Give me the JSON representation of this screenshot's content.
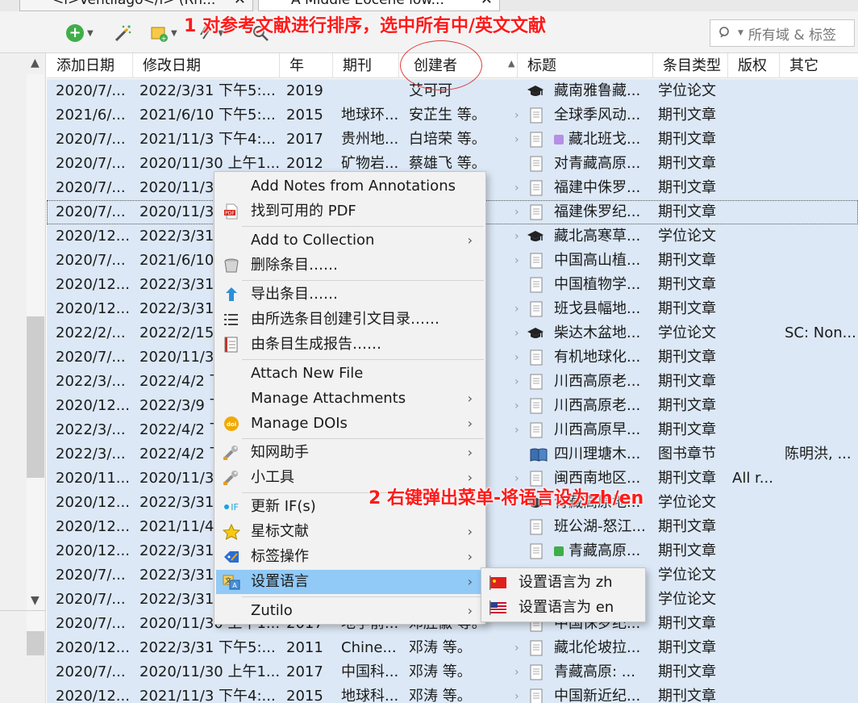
{
  "tabs": [
    {
      "label": "<i>Ventilago</i> (Rh...",
      "close": "✕"
    },
    {
      "label": "A Middle Eocene low...",
      "close": "✕"
    }
  ],
  "toolbar": {
    "search_placeholder": "所有域 & 标签"
  },
  "columns": [
    "添加日期",
    "修改日期",
    "年",
    "期刊",
    "创建者",
    "标题",
    "条目类型",
    "版权",
    "其它"
  ],
  "rows": [
    {
      "added": "2020/7/...",
      "modified": "2022/3/31 下午5:...",
      "year": "2019",
      "journal": "",
      "creator": "艾可可",
      "twisty": false,
      "icon": "thesis",
      "tag": "",
      "title": "藏南雅鲁藏...",
      "type": "学位论文",
      "rights": "",
      "extra": ""
    },
    {
      "added": "2021/6/...",
      "modified": "2021/6/10 下午5:...",
      "year": "2015",
      "journal": "地球环...",
      "creator": "安芷生 等。",
      "twisty": true,
      "icon": "article",
      "tag": "",
      "title": "全球季风动...",
      "type": "期刊文章",
      "rights": "",
      "extra": ""
    },
    {
      "added": "2020/7/...",
      "modified": "2021/11/3 下午4:...",
      "year": "2017",
      "journal": "贵州地...",
      "creator": "白培荣 等。",
      "twisty": true,
      "icon": "article",
      "tag": "#b58ee6",
      "title": "藏北班戈...",
      "type": "期刊文章",
      "rights": "",
      "extra": ""
    },
    {
      "added": "2020/7/...",
      "modified": "2020/11/30 上午1...",
      "year": "2012",
      "journal": "矿物岩...",
      "creator": "蔡雄飞 等。",
      "twisty": false,
      "icon": "article",
      "tag": "",
      "title": "对青藏高原...",
      "type": "期刊文章",
      "rights": "",
      "extra": ""
    },
    {
      "added": "2020/7/...",
      "modified": "2020/11/30",
      "year": "",
      "journal": "",
      "creator": "",
      "twisty": true,
      "icon": "article",
      "tag": "",
      "title": "福建中侏罗...",
      "type": "期刊文章",
      "rights": "",
      "extra": ""
    },
    {
      "added": "2020/7/...",
      "modified": "2020/11/30",
      "year": "",
      "journal": "",
      "creator": "",
      "twisty": true,
      "icon": "article",
      "tag": "",
      "title": "福建侏罗纪...",
      "type": "期刊文章",
      "rights": "",
      "extra": ""
    },
    {
      "added": "2020/12...",
      "modified": "2022/3/31",
      "year": "",
      "journal": "",
      "creator": "",
      "twisty": true,
      "icon": "thesis",
      "tag": "",
      "title": "藏北高寒草...",
      "type": "学位论文",
      "rights": "",
      "extra": ""
    },
    {
      "added": "2020/7/...",
      "modified": "2021/6/10",
      "year": "",
      "journal": "",
      "creator": "",
      "twisty": true,
      "icon": "article",
      "tag": "",
      "title": "中国高山植...",
      "type": "期刊文章",
      "rights": "",
      "extra": ""
    },
    {
      "added": "2020/12...",
      "modified": "2022/3/31",
      "year": "",
      "journal": "",
      "creator": "",
      "twisty": false,
      "icon": "article",
      "tag": "",
      "title": "中国植物学...",
      "type": "期刊文章",
      "rights": "",
      "extra": ""
    },
    {
      "added": "2020/12...",
      "modified": "2022/3/31",
      "year": "",
      "journal": "",
      "creator": "",
      "twisty": true,
      "icon": "article",
      "tag": "",
      "title": "班戈县幅地...",
      "type": "期刊文章",
      "rights": "",
      "extra": ""
    },
    {
      "added": "2022/2/...",
      "modified": "2022/2/15",
      "year": "",
      "journal": "",
      "creator": "",
      "twisty": true,
      "icon": "thesis",
      "tag": "",
      "title": "柴达木盆地...",
      "type": "学位论文",
      "rights": "",
      "extra": "SC: Non..."
    },
    {
      "added": "2020/7/...",
      "modified": "2020/11/30",
      "year": "",
      "journal": "",
      "creator": "",
      "twisty": true,
      "icon": "article",
      "tag": "",
      "title": "有机地球化...",
      "type": "期刊文章",
      "rights": "",
      "extra": ""
    },
    {
      "added": "2022/3/...",
      "modified": "2022/4/2 下",
      "year": "",
      "journal": "",
      "creator": "",
      "twisty": true,
      "icon": "article",
      "tag": "",
      "title": "川西高原老...",
      "type": "期刊文章",
      "rights": "",
      "extra": ""
    },
    {
      "added": "2020/12...",
      "modified": "2022/3/9 下",
      "year": "",
      "journal": "",
      "creator": "",
      "twisty": true,
      "icon": "article",
      "tag": "",
      "title": "川西高原老...",
      "type": "期刊文章",
      "rights": "",
      "extra": ""
    },
    {
      "added": "2022/3/...",
      "modified": "2022/4/2 下",
      "year": "",
      "journal": "",
      "creator": "",
      "twisty": true,
      "icon": "article",
      "tag": "",
      "title": "川西高原早...",
      "type": "期刊文章",
      "rights": "",
      "extra": ""
    },
    {
      "added": "2022/3/...",
      "modified": "2022/4/2 下",
      "year": "",
      "journal": "",
      "creator": "",
      "twisty": false,
      "icon": "book",
      "tag": "",
      "title": "四川理塘木...",
      "type": "图书章节",
      "rights": "",
      "extra": "陈明洪, ..."
    },
    {
      "added": "2020/11...",
      "modified": "2020/11/30",
      "year": "",
      "journal": "",
      "creator": "",
      "twisty": true,
      "icon": "article",
      "tag": "",
      "title": "闽西南地区...",
      "type": "期刊文章",
      "rights": "All r...",
      "extra": ""
    },
    {
      "added": "2020/12...",
      "modified": "2022/3/31",
      "year": "",
      "journal": "",
      "creator": "",
      "twisty": false,
      "icon": "thesis",
      "tag": "",
      "title": "青藏高原地...",
      "type": "学位论文",
      "rights": "",
      "extra": ""
    },
    {
      "added": "2020/12...",
      "modified": "2021/11/4",
      "year": "",
      "journal": "",
      "creator": "",
      "twisty": false,
      "icon": "article",
      "tag": "",
      "title": "班公湖-怒江...",
      "type": "期刊文章",
      "rights": "",
      "extra": ""
    },
    {
      "added": "2020/12...",
      "modified": "2022/3/31",
      "year": "",
      "journal": "",
      "creator": "",
      "twisty": false,
      "icon": "article",
      "tag": "#3fae49",
      "title": "青藏高原...",
      "type": "期刊文章",
      "rights": "",
      "extra": ""
    },
    {
      "added": "2020/7/...",
      "modified": "2022/3/31",
      "year": "",
      "journal": "",
      "creator": "",
      "twisty": false,
      "icon": "thesis",
      "tag": "",
      "title": "",
      "type": "学位论文",
      "rights": "",
      "extra": ""
    },
    {
      "added": "2020/7/...",
      "modified": "2022/3/31",
      "year": "",
      "journal": "",
      "creator": "",
      "twisty": false,
      "icon": "thesis",
      "tag": "",
      "title": "",
      "type": "学位论文",
      "rights": "",
      "extra": ""
    },
    {
      "added": "2020/7/...",
      "modified": "2020/11/30 上午1...",
      "year": "2017",
      "journal": "地学前...",
      "creator": "邓胜徽 等。",
      "twisty": false,
      "icon": "article",
      "tag": "",
      "title": "中国侏罗纪...",
      "type": "期刊文章",
      "rights": "",
      "extra": ""
    },
    {
      "added": "2020/12...",
      "modified": "2022/3/31 下午5:...",
      "year": "2011",
      "journal": "Chine...",
      "creator": "邓涛 等。",
      "twisty": true,
      "icon": "article",
      "tag": "",
      "title": "藏北伦坡拉...",
      "type": "期刊文章",
      "rights": "",
      "extra": ""
    },
    {
      "added": "2020/7/...",
      "modified": "2020/11/30 上午1...",
      "year": "2017",
      "journal": "中国科...",
      "creator": "邓涛 等。",
      "twisty": true,
      "icon": "article",
      "tag": "",
      "title": "青藏高原: ...",
      "type": "期刊文章",
      "rights": "",
      "extra": ""
    },
    {
      "added": "2020/12...",
      "modified": "2021/11/3 下午4:...",
      "year": "2015",
      "journal": "地球科...",
      "creator": "邓涛 等。",
      "twisty": true,
      "icon": "article",
      "tag": "",
      "title": "中国新近纪...",
      "type": "期刊文章",
      "rights": "",
      "extra": ""
    }
  ],
  "context_menu": [
    {
      "label": "Add Notes from Annotations",
      "icon": "none",
      "sub": false
    },
    {
      "label": "找到可用的 PDF",
      "icon": "pdf-icon",
      "sub": false
    },
    {
      "sep": true
    },
    {
      "label": "Add to Collection",
      "icon": "none",
      "sub": true
    },
    {
      "label": "删除条目……",
      "icon": "trash-icon",
      "sub": false
    },
    {
      "sep": true
    },
    {
      "label": "导出条目……",
      "icon": "export-arrow-icon",
      "sub": false
    },
    {
      "label": "由所选条目创建引文目录……",
      "icon": "bibliography-list-icon",
      "sub": false
    },
    {
      "label": "由条目生成报告……",
      "icon": "report-icon",
      "sub": false
    },
    {
      "sep": true
    },
    {
      "label": "Attach New File",
      "icon": "none",
      "sub": false
    },
    {
      "label": "Manage Attachments",
      "icon": "none",
      "sub": true
    },
    {
      "label": "Manage DOIs",
      "icon": "doi-icon",
      "sub": true
    },
    {
      "sep": true
    },
    {
      "label": "知网助手",
      "icon": "wrench-icon",
      "sub": true
    },
    {
      "label": "小工具",
      "icon": "wrench-icon",
      "sub": true
    },
    {
      "sep": true
    },
    {
      "label": "更新 IF(s)",
      "icon": "if-icon",
      "sub": false
    },
    {
      "label": "星标文献",
      "icon": "star-icon",
      "sub": true
    },
    {
      "label": "标签操作",
      "icon": "tag-edit-icon",
      "sub": true
    },
    {
      "label": "设置语言",
      "icon": "language-icon",
      "sub": true,
      "highlight": true
    },
    {
      "sep": true
    },
    {
      "label": "Zutilo",
      "icon": "none",
      "sub": true
    }
  ],
  "submenu": [
    {
      "label": "设置语言为 zh",
      "icon": "china-flag-icon"
    },
    {
      "label": "设置语言为 en",
      "icon": "us-flag-icon"
    }
  ],
  "annotations": {
    "step1": "1 对参考文献进行排序，选中所有中/英文文献",
    "step2": "2 右键弹出菜单-将语言设为zh/en"
  },
  "colors": {
    "row_selected": "#dce8f6",
    "menu_highlight": "#91c9f7",
    "annotation_red": "#ff1a1a"
  }
}
